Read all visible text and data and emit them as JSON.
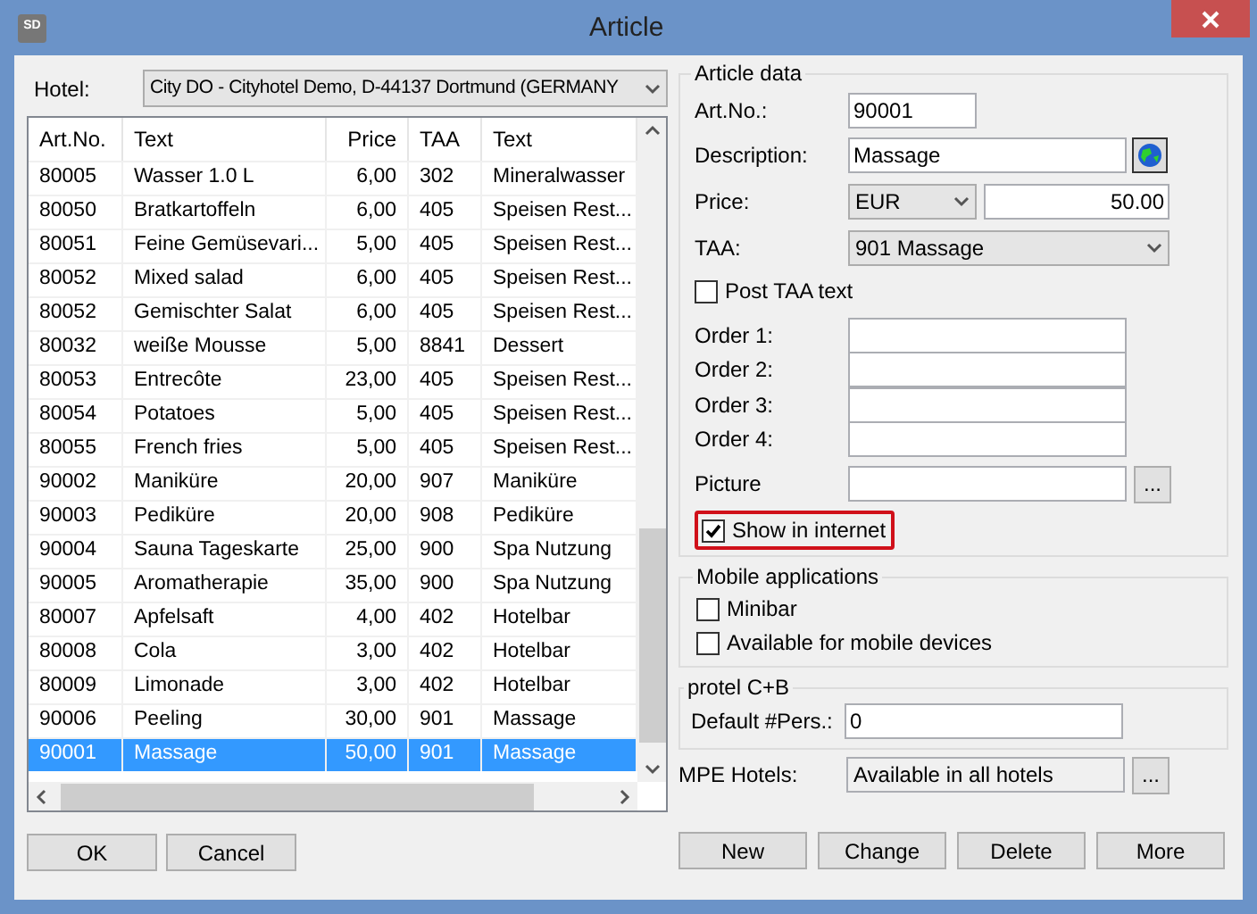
{
  "window": {
    "title": "Article",
    "icon_text": "SD"
  },
  "hotel": {
    "label": "Hotel:",
    "value": "City DO - Cityhotel Demo, D-44137 Dortmund (GERMANY"
  },
  "table": {
    "columns": [
      "Art.No.",
      "Text",
      "Price",
      "TAA",
      "Text"
    ],
    "rows": [
      {
        "cells": [
          "80005",
          "Wasser 1.0 L",
          "6,00",
          "302",
          "Mineralwasser"
        ],
        "selected": false
      },
      {
        "cells": [
          "80050",
          "Bratkartoffeln",
          "6,00",
          "405",
          "Speisen Rest..."
        ],
        "selected": false
      },
      {
        "cells": [
          "80051",
          "Feine Gemüsevari...",
          "5,00",
          "405",
          "Speisen Rest..."
        ],
        "selected": false
      },
      {
        "cells": [
          "80052",
          "Mixed salad",
          "6,00",
          "405",
          "Speisen Rest..."
        ],
        "selected": false
      },
      {
        "cells": [
          "80052",
          "Gemischter Salat",
          "6,00",
          "405",
          "Speisen Rest..."
        ],
        "selected": false
      },
      {
        "cells": [
          "80032",
          "weiße Mousse",
          "5,00",
          "8841",
          "Dessert"
        ],
        "selected": false
      },
      {
        "cells": [
          "80053",
          "Entrecôte",
          "23,00",
          "405",
          "Speisen Rest..."
        ],
        "selected": false
      },
      {
        "cells": [
          "80054",
          "Potatoes",
          "5,00",
          "405",
          "Speisen Rest..."
        ],
        "selected": false
      },
      {
        "cells": [
          "80055",
          "French fries",
          "5,00",
          "405",
          "Speisen Rest..."
        ],
        "selected": false
      },
      {
        "cells": [
          "90002",
          "Maniküre",
          "20,00",
          "907",
          "Maniküre"
        ],
        "selected": false
      },
      {
        "cells": [
          "90003",
          "Pediküre",
          "20,00",
          "908",
          "Pediküre"
        ],
        "selected": false
      },
      {
        "cells": [
          "90004",
          "Sauna Tageskarte",
          "25,00",
          "900",
          "Spa Nutzung"
        ],
        "selected": false
      },
      {
        "cells": [
          "90005",
          "Aromatherapie",
          "35,00",
          "900",
          "Spa Nutzung"
        ],
        "selected": false
      },
      {
        "cells": [
          "80007",
          "Apfelsaft",
          "4,00",
          "402",
          "Hotelbar"
        ],
        "selected": false
      },
      {
        "cells": [
          "80008",
          "Cola",
          "3,00",
          "402",
          "Hotelbar"
        ],
        "selected": false
      },
      {
        "cells": [
          "80009",
          "Limonade",
          "3,00",
          "402",
          "Hotelbar"
        ],
        "selected": false
      },
      {
        "cells": [
          "90006",
          "Peeling",
          "30,00",
          "901",
          "Massage"
        ],
        "selected": false
      },
      {
        "cells": [
          "90001",
          "Massage",
          "50,00",
          "901",
          "Massage"
        ],
        "selected": true
      }
    ]
  },
  "left_buttons": [
    "OK",
    "Cancel"
  ],
  "article_data": {
    "title": "Article data",
    "art_no": {
      "label": "Art.No.:",
      "value": "90001"
    },
    "description": {
      "label": "Description:",
      "value": "Massage"
    },
    "price": {
      "label": "Price:",
      "currency": "EUR",
      "value": "50.00"
    },
    "taa": {
      "label": "TAA:",
      "value": "901 Massage"
    },
    "post_taa_text": {
      "label": "Post TAA text",
      "checked": false
    },
    "orders": [
      {
        "label": "Order 1:"
      },
      {
        "label": "Order 2:"
      },
      {
        "label": "Order 3:"
      },
      {
        "label": "Order 4:"
      }
    ],
    "picture": {
      "label": "Picture",
      "button": "..."
    },
    "show_in_internet": {
      "label": "Show in internet",
      "checked": true
    }
  },
  "mobile_applications": {
    "title": "Mobile applications",
    "options": [
      {
        "label": "Minibar",
        "checked": false
      },
      {
        "label": "Available for mobile devices",
        "checked": false
      }
    ]
  },
  "protel": {
    "title": "protel C+B",
    "default_pers": {
      "label": "Default #Pers.:",
      "value": "0"
    }
  },
  "mpe_hotels": {
    "label": "MPE Hotels:",
    "value": "Available in all hotels",
    "button": "..."
  },
  "right_buttons": [
    "New",
    "Change",
    "Delete",
    "More"
  ]
}
